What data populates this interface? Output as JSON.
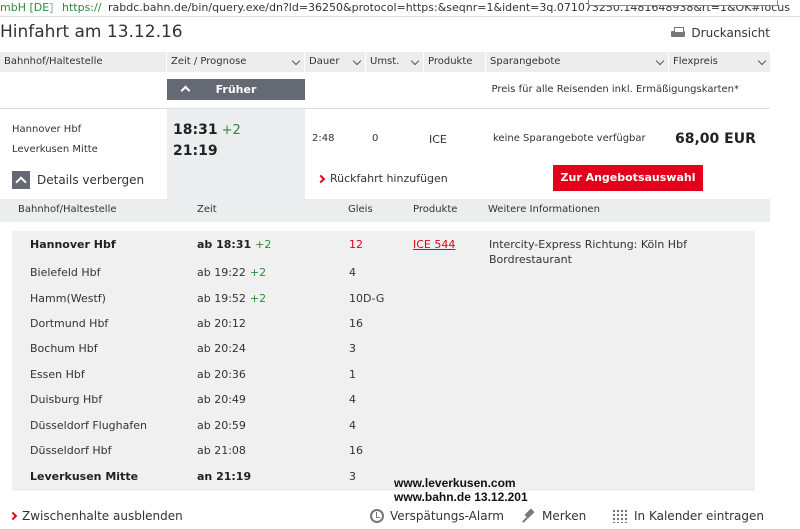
{
  "browser": {
    "company": "mbH [DE]",
    "sep": "|",
    "https": "https://",
    "url_rest": "rabdc.bahn.de/bin/query.exe/dn?ld=36250&protocol=https:&seqnr=1&ident=3q.071073250.1481648938&rt=1&OK#focus"
  },
  "header": {
    "title": "Hinfahrt am 13.12.16",
    "print_label": "Druckansicht"
  },
  "columns": [
    "Bahnhof/Haltestelle",
    "Zeit / Prognose",
    "Dauer",
    "Umst.",
    "Produkte",
    "Sparangebote",
    "Flexpreis"
  ],
  "frueher_label": "Früher",
  "preis_note": "Preis für alle Reisenden inkl. Ermäßigungskarten*",
  "connection": {
    "from": "Hannover Hbf",
    "to": "Leverkusen Mitte",
    "dep_time": "18:31",
    "dep_delay": "+2",
    "arr_time": "21:19",
    "duration": "2:48",
    "changes": "0",
    "product": "ICE",
    "spar": "keine Sparangebote verfügbar",
    "price": "68,00 EUR",
    "details_label": "Details verbergen",
    "return_label": "Rückfahrt hinzufügen",
    "offer_button": "Zur Angebotsauswahl"
  },
  "detail_columns": [
    "Bahnhof/Haltestelle",
    "Zeit",
    "Gleis",
    "Produkte",
    "Weitere Informationen"
  ],
  "stops": [
    {
      "name": "Hannover Hbf",
      "time": "ab 18:31",
      "delay": "+2",
      "track": "12"
    },
    {
      "name": "Bielefeld Hbf",
      "time": "ab 19:22",
      "delay": "+2",
      "track": "4"
    },
    {
      "name": "Hamm(Westf)",
      "time": "ab 19:52",
      "delay": "+2",
      "track": "10D-G"
    },
    {
      "name": "Dortmund Hbf",
      "time": "ab 20:12",
      "delay": "",
      "track": "16"
    },
    {
      "name": "Bochum Hbf",
      "time": "ab 20:24",
      "delay": "",
      "track": "3"
    },
    {
      "name": "Essen Hbf",
      "time": "ab 20:36",
      "delay": "",
      "track": "1"
    },
    {
      "name": "Duisburg Hbf",
      "time": "ab 20:49",
      "delay": "",
      "track": "4"
    },
    {
      "name": "Düsseldorf Flughafen",
      "time": "ab 20:59",
      "delay": "",
      "track": "4"
    },
    {
      "name": "Düsseldorf Hbf",
      "time": "ab 21:08",
      "delay": "",
      "track": "16"
    },
    {
      "name": "Leverkusen Mitte",
      "time": "an 21:19",
      "delay": "",
      "track": "3"
    }
  ],
  "train": {
    "product": "ICE 544",
    "info_line1": "Intercity-Express Richtung: Köln Hbf",
    "info_line2": "Bordrestaurant"
  },
  "watermark": {
    "line1": "www.leverkusen.com",
    "line2": "www.bahn.de 13.12.201"
  },
  "bottom": {
    "zwischenhalte": "Zwischenhalte ausblenden",
    "alarm": "Verspätungs-Alarm",
    "merken": "Merken",
    "kalender": "In Kalender eintragen"
  },
  "colors": {
    "db_red": "#e2001a",
    "delay_green": "#2a8a3a",
    "button_grey": "#646973",
    "panel_grey": "#f0f0f0"
  }
}
